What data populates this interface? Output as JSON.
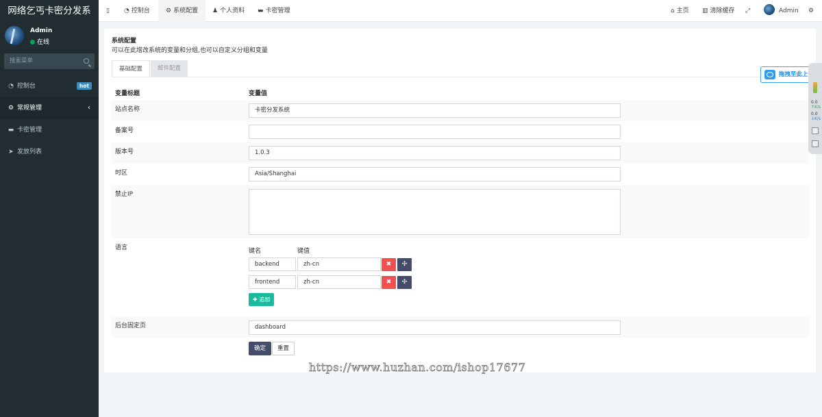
{
  "app": {
    "title": "网络乞丐卡密分发系"
  },
  "user": {
    "name": "Admin",
    "status": "在线"
  },
  "search": {
    "placeholder": "搜索菜单"
  },
  "sidebar": {
    "items": [
      {
        "icon": "dashboard-icon",
        "label": "控制台",
        "badge": "hot"
      },
      {
        "icon": "cogs-icon",
        "label": "常规管理",
        "chevron": "‹"
      },
      {
        "icon": "card-icon",
        "label": "卡密管理"
      },
      {
        "icon": "send-icon",
        "label": "发放列表"
      }
    ]
  },
  "topnav": {
    "toggle": "▯",
    "tabs": [
      {
        "icon": "dashboard-icon",
        "label": "控制台"
      },
      {
        "icon": "gear-icon",
        "label": "系统配置"
      },
      {
        "icon": "user-icon",
        "label": "个人资料"
      },
      {
        "icon": "card-icon",
        "label": "卡密管理"
      }
    ],
    "right": {
      "home": "主页",
      "clear_cache": "清除缓存",
      "admin": "Admin"
    }
  },
  "panel": {
    "title": "系统配置",
    "description": "可以在此增改系统的变量和分组,也可以自定义分组和变量",
    "tabs": [
      "基础配置",
      "邮件配置"
    ],
    "header": {
      "name": "变量标题",
      "value": "变量值"
    },
    "fields": {
      "site_name": {
        "label": "站点名称",
        "value": "卡密分发系统"
      },
      "beian": {
        "label": "备案号",
        "value": ""
      },
      "version": {
        "label": "版本号",
        "value": "1.0.3"
      },
      "timezone": {
        "label": "时区",
        "value": "Asia/Shanghai"
      },
      "forbidden_ip": {
        "label": "禁止IP",
        "value": ""
      },
      "language": {
        "label": "语言",
        "key_header": "键名",
        "value_header": "键值",
        "rows": [
          {
            "key": "backend",
            "value": "zh-cn"
          },
          {
            "key": "frontend",
            "value": "zh-cn"
          }
        ],
        "add_label": "追加",
        "delete_glyph": "✖",
        "move_glyph": "✣"
      },
      "fixed_page": {
        "label": "后台固定页",
        "value": "dashboard"
      }
    },
    "buttons": {
      "ok": "确定",
      "reset": "重置"
    }
  },
  "floating": {
    "upload": "拖拽至此上传",
    "speed_up": "0.0",
    "speed_up_unit": "K/s",
    "speed_down": "0.0",
    "speed_down_unit": "K/s"
  },
  "watermark": "https://www.huzhan.com/ishop17677",
  "colors": {
    "sidebar_bg": "#222d32",
    "primary": "#444c69",
    "danger": "#f05050",
    "success": "#18bc9c",
    "hot_badge": "#3c8dbc"
  }
}
